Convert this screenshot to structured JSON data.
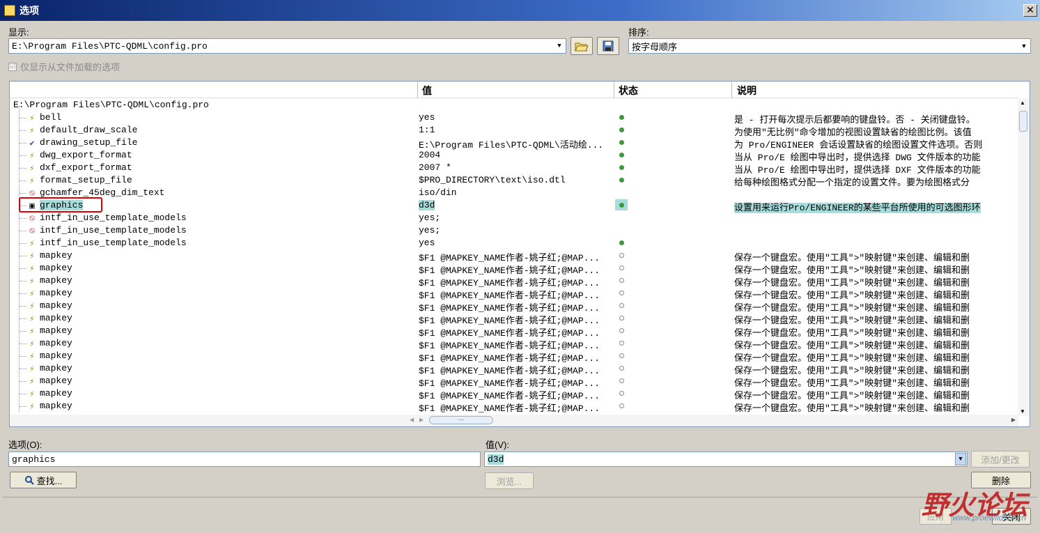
{
  "window": {
    "title": "选项",
    "close": "✕"
  },
  "show": {
    "label": "显示:",
    "value": "E:\\Program Files\\PTC-QDML\\config.pro"
  },
  "sort": {
    "label": "排序:",
    "value": "按字母顺序"
  },
  "only_loaded": {
    "label": "仅显示从文件加载的选项",
    "checked": "☑"
  },
  "table": {
    "headers": {
      "value": "值",
      "status": "状态",
      "desc": "说明"
    },
    "root": "E:\\Program Files\\PTC-QDML\\config.pro",
    "rows": [
      {
        "icon": "⚡",
        "name": "bell",
        "value": "yes",
        "status": "green",
        "desc": "是 - 打开每次提示后都要响的键盘铃。否 - 关闭键盘铃。"
      },
      {
        "icon": "⚡",
        "name": "default_draw_scale",
        "value": "1:1",
        "status": "green",
        "desc": "为使用\"无比例\"命令增加的视图设置缺省的绘图比例。该值"
      },
      {
        "icon": "✔",
        "name": "drawing_setup_file",
        "value": "E:\\Program Files\\PTC-QDML\\活动绘...",
        "status": "green",
        "desc": "为 Pro/ENGINEER 会话设置缺省的绘图设置文件选项。否则"
      },
      {
        "icon": "⚡",
        "name": "dwg_export_format",
        "value": "2004",
        "status": "green",
        "desc": "当从 Pro/E 绘图中导出时，提供选择 DWG 文件版本的功能"
      },
      {
        "icon": "⚡",
        "name": "dxf_export_format",
        "value": "2007 *",
        "status": "green",
        "desc": "当从 Pro/E 绘图中导出时，提供选择 DXF 文件版本的功能"
      },
      {
        "icon": "⚡",
        "name": "format_setup_file",
        "value": "$PRO_DIRECTORY\\text\\iso.dtl",
        "status": "green",
        "desc": "给每种绘图格式分配一个指定的设置文件。要为绘图格式分"
      },
      {
        "icon": "⦸",
        "name": "gchamfer_45deg_dim_text",
        "value": "iso/din",
        "status": "",
        "desc": ""
      },
      {
        "icon": "▣",
        "name": "graphics",
        "value": "d3d",
        "status": "green",
        "desc": "设置用来运行Pro/ENGINEER的某些平台所使用的可选图形环"
      },
      {
        "icon": "⦸",
        "name": "intf_in_use_template_models",
        "value": "yes;",
        "status": "",
        "desc": ""
      },
      {
        "icon": "⦸",
        "name": "intf_in_use_template_models",
        "value": "yes;",
        "status": "",
        "desc": ""
      },
      {
        "icon": "⚡",
        "name": "intf_in_use_template_models",
        "value": "yes",
        "status": "green",
        "desc": ""
      },
      {
        "icon": "⚡",
        "name": "mapkey",
        "value": "$F1 @MAPKEY_NAME作者-姚子红;@MAP...",
        "status": "hollow",
        "desc": "保存一个键盘宏。使用\"工具\">\"映射键\"来创建、编辑和删"
      },
      {
        "icon": "⚡",
        "name": "mapkey",
        "value": "$F1 @MAPKEY_NAME作者-姚子红;@MAP...",
        "status": "hollow",
        "desc": "保存一个键盘宏。使用\"工具\">\"映射键\"来创建、编辑和删"
      },
      {
        "icon": "⚡",
        "name": "mapkey",
        "value": "$F1 @MAPKEY_NAME作者-姚子红;@MAP...",
        "status": "hollow",
        "desc": "保存一个键盘宏。使用\"工具\">\"映射键\"来创建、编辑和删"
      },
      {
        "icon": "⚡",
        "name": "mapkey",
        "value": "$F1 @MAPKEY_NAME作者-姚子红;@MAP...",
        "status": "hollow",
        "desc": "保存一个键盘宏。使用\"工具\">\"映射键\"来创建、编辑和删"
      },
      {
        "icon": "⚡",
        "name": "mapkey",
        "value": "$F1 @MAPKEY_NAME作者-姚子红;@MAP...",
        "status": "hollow",
        "desc": "保存一个键盘宏。使用\"工具\">\"映射键\"来创建、编辑和删"
      },
      {
        "icon": "⚡",
        "name": "mapkey",
        "value": "$F1 @MAPKEY_NAME作者-姚子红;@MAP...",
        "status": "hollow",
        "desc": "保存一个键盘宏。使用\"工具\">\"映射键\"来创建、编辑和删"
      },
      {
        "icon": "⚡",
        "name": "mapkey",
        "value": "$F1 @MAPKEY_NAME作者-姚子红;@MAP...",
        "status": "hollow",
        "desc": "保存一个键盘宏。使用\"工具\">\"映射键\"来创建、编辑和删"
      },
      {
        "icon": "⚡",
        "name": "mapkey",
        "value": "$F1 @MAPKEY_NAME作者-姚子红;@MAP...",
        "status": "hollow",
        "desc": "保存一个键盘宏。使用\"工具\">\"映射键\"来创建、编辑和删"
      },
      {
        "icon": "⚡",
        "name": "mapkey",
        "value": "$F1 @MAPKEY_NAME作者-姚子红;@MAP...",
        "status": "hollow",
        "desc": "保存一个键盘宏。使用\"工具\">\"映射键\"来创建、编辑和删"
      },
      {
        "icon": "⚡",
        "name": "mapkey",
        "value": "$F1 @MAPKEY_NAME作者-姚子红;@MAP...",
        "status": "hollow",
        "desc": "保存一个键盘宏。使用\"工具\">\"映射键\"来创建、编辑和删"
      },
      {
        "icon": "⚡",
        "name": "mapkey",
        "value": "$F1 @MAPKEY_NAME作者-姚子红;@MAP...",
        "status": "hollow",
        "desc": "保存一个键盘宏。使用\"工具\">\"映射键\"来创建、编辑和删"
      },
      {
        "icon": "⚡",
        "name": "mapkey",
        "value": "$F1 @MAPKEY_NAME作者-姚子红;@MAP...",
        "status": "hollow",
        "desc": "保存一个键盘宏。使用\"工具\">\"映射键\"来创建、编辑和删"
      },
      {
        "icon": "⚡",
        "name": "mapkey",
        "value": "$F1 @MAPKEY_NAME作者-姚子红;@MAP...",
        "status": "hollow",
        "desc": "保存一个键盘宏。使用\"工具\">\"映射键\"来创建、编辑和删"
      }
    ]
  },
  "option_field": {
    "label": "选项(O):",
    "value": "graphics"
  },
  "value_field": {
    "label": "值(V):",
    "value": "d3d"
  },
  "buttons": {
    "find": "查找...",
    "browse": "浏览...",
    "add_change": "添加/更改",
    "delete": "删除",
    "apply": "应用",
    "close": "关闭"
  },
  "watermark": {
    "text": "野火论坛",
    "url": "www.proewildfire.cn"
  },
  "colors": {
    "status_green": "#3c9a3c",
    "highlight": "#a6dcdc",
    "annotation_red": "#e00000"
  }
}
